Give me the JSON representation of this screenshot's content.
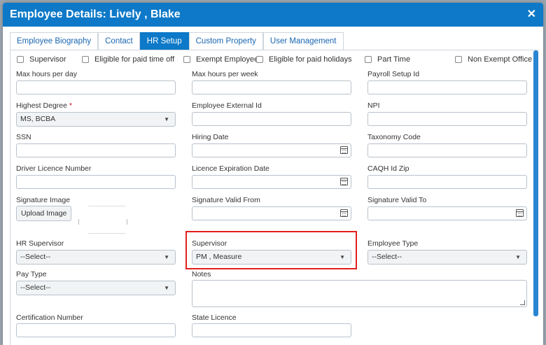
{
  "dialog": {
    "title": "Employee Details: Lively , Blake",
    "close_glyph": "✕"
  },
  "tabs": [
    {
      "label": "Employee Biography",
      "active": false
    },
    {
      "label": "Contact",
      "active": false
    },
    {
      "label": "HR Setup",
      "active": true
    },
    {
      "label": "Custom Property",
      "active": false
    },
    {
      "label": "User Management",
      "active": false
    }
  ],
  "checkboxes": {
    "supervisor": "Supervisor",
    "paid_time_off": "Eligible for paid time off",
    "exempt_employee": "Exempt Employee",
    "paid_holidays": "Eligible for paid holidays",
    "part_time": "Part Time",
    "non_exempt_office": "Non Exempt Office"
  },
  "fields": {
    "max_hours_day": {
      "label": "Max hours per day",
      "value": ""
    },
    "max_hours_week": {
      "label": "Max hours per week",
      "value": ""
    },
    "payroll_setup_id": {
      "label": "Payroll Setup Id",
      "value": ""
    },
    "highest_degree": {
      "label": "Highest Degree",
      "required": "*",
      "value": "MS, BCBA"
    },
    "employee_external_id": {
      "label": "Employee External Id",
      "value": ""
    },
    "npi": {
      "label": "NPI",
      "value": ""
    },
    "ssn": {
      "label": "SSN",
      "value": ""
    },
    "hiring_date": {
      "label": "Hiring Date",
      "value": ""
    },
    "taxonomy_code": {
      "label": "Taxonomy Code",
      "value": ""
    },
    "driver_licence_number": {
      "label": "Driver Licence Number",
      "value": ""
    },
    "licence_expiration_date": {
      "label": "Licence Expiration Date",
      "value": ""
    },
    "caqh_id_zip": {
      "label": "CAQH Id Zip",
      "value": ""
    },
    "signature_image": {
      "label": "Signature Image",
      "button": "Upload Image"
    },
    "signature_valid_from": {
      "label": "Signature Valid From",
      "value": ""
    },
    "signature_valid_to": {
      "label": "Signature Valid To",
      "value": ""
    },
    "hr_supervisor": {
      "label": "HR Supervisor",
      "value": "--Select--"
    },
    "supervisor": {
      "label": "Supervisor",
      "value": "PM , Measure"
    },
    "employee_type": {
      "label": "Employee Type",
      "value": "--Select--"
    },
    "pay_type": {
      "label": "Pay Type",
      "value": "--Select--"
    },
    "notes": {
      "label": "Notes",
      "value": ""
    },
    "certification_number": {
      "label": "Certification Number",
      "value": ""
    },
    "state_licence": {
      "label": "State Licence",
      "value": ""
    }
  },
  "icons": {
    "caret": "▼",
    "calendar": "calendar-icon"
  },
  "colors": {
    "header": "#0d79c8",
    "highlight": "#e0201c"
  }
}
